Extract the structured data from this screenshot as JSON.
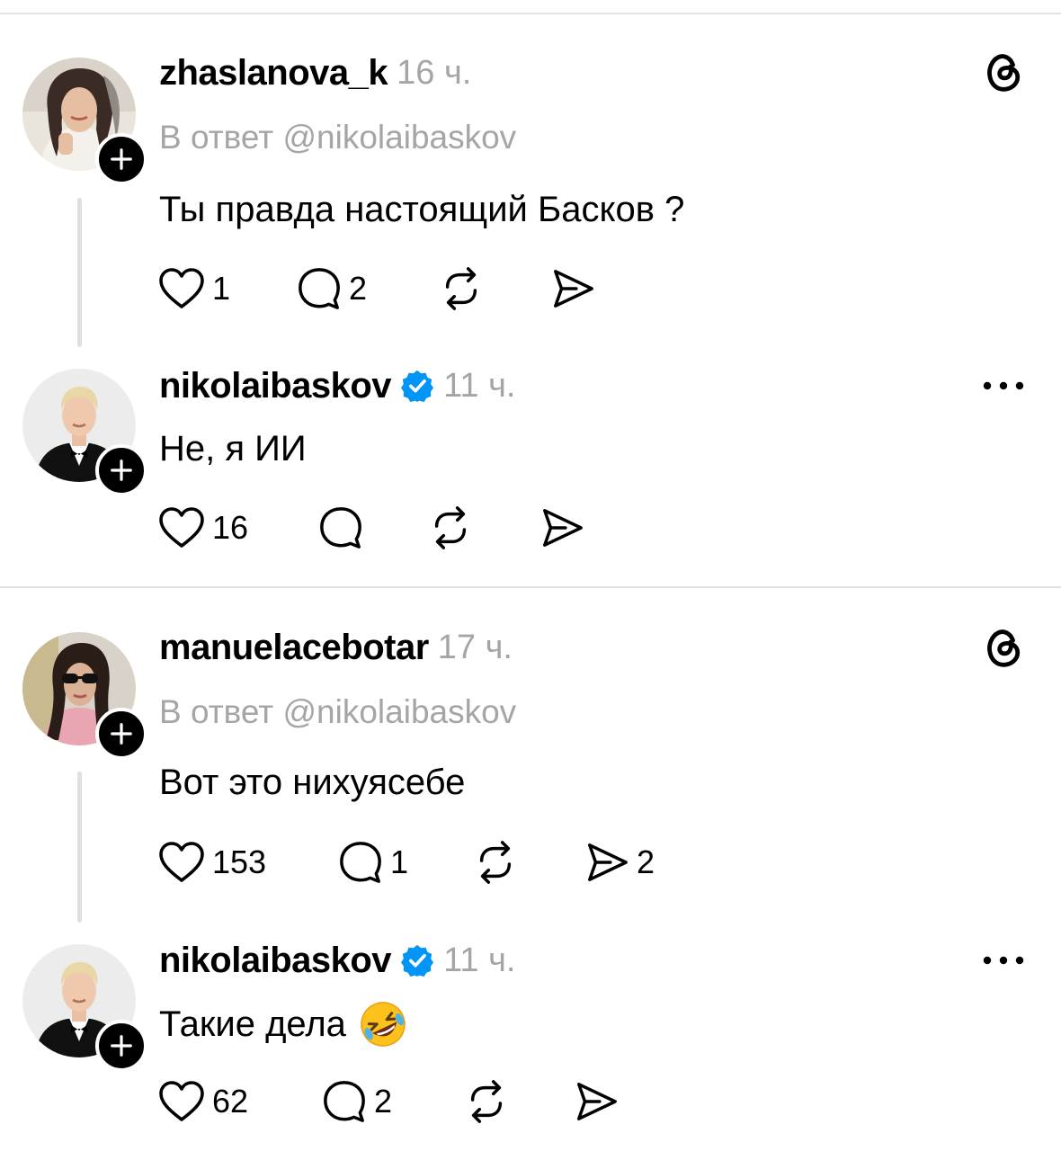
{
  "threads": [
    {
      "original": {
        "username": "zhaslanova_k",
        "time": "16 ч.",
        "reply_to": "В ответ @nikolaibaskov",
        "text": "Ты правда настоящий Басков ?",
        "likes": "1",
        "replies": "2",
        "shares": "",
        "corner_icon": "threads-logo-icon"
      },
      "reply": {
        "username": "nikolaibaskov",
        "verified": true,
        "time": "11 ч.",
        "text": "Не, я ИИ",
        "likes": "16",
        "replies": "",
        "shares": "",
        "corner_icon": "more-options-icon"
      }
    },
    {
      "original": {
        "username": "manuelacebotar",
        "time": "17 ч.",
        "reply_to": "В ответ @nikolaibaskov",
        "text": "Вот это нихуясебе",
        "likes": "153",
        "replies": "1",
        "shares": "2",
        "corner_icon": "threads-logo-icon"
      },
      "reply": {
        "username": "nikolaibaskov",
        "verified": true,
        "time": "11 ч.",
        "text": "Такие дела",
        "emoji": "rolling-on-floor-laughing-emoji",
        "likes": "62",
        "replies": "2",
        "shares": "",
        "corner_icon": "more-options-icon"
      }
    }
  ],
  "colors": {
    "text": "#000000",
    "secondary": "#a5a5a5",
    "verified": "#0095f6",
    "divider": "#e3e3e3",
    "thread_line": "#e0e0e0"
  }
}
